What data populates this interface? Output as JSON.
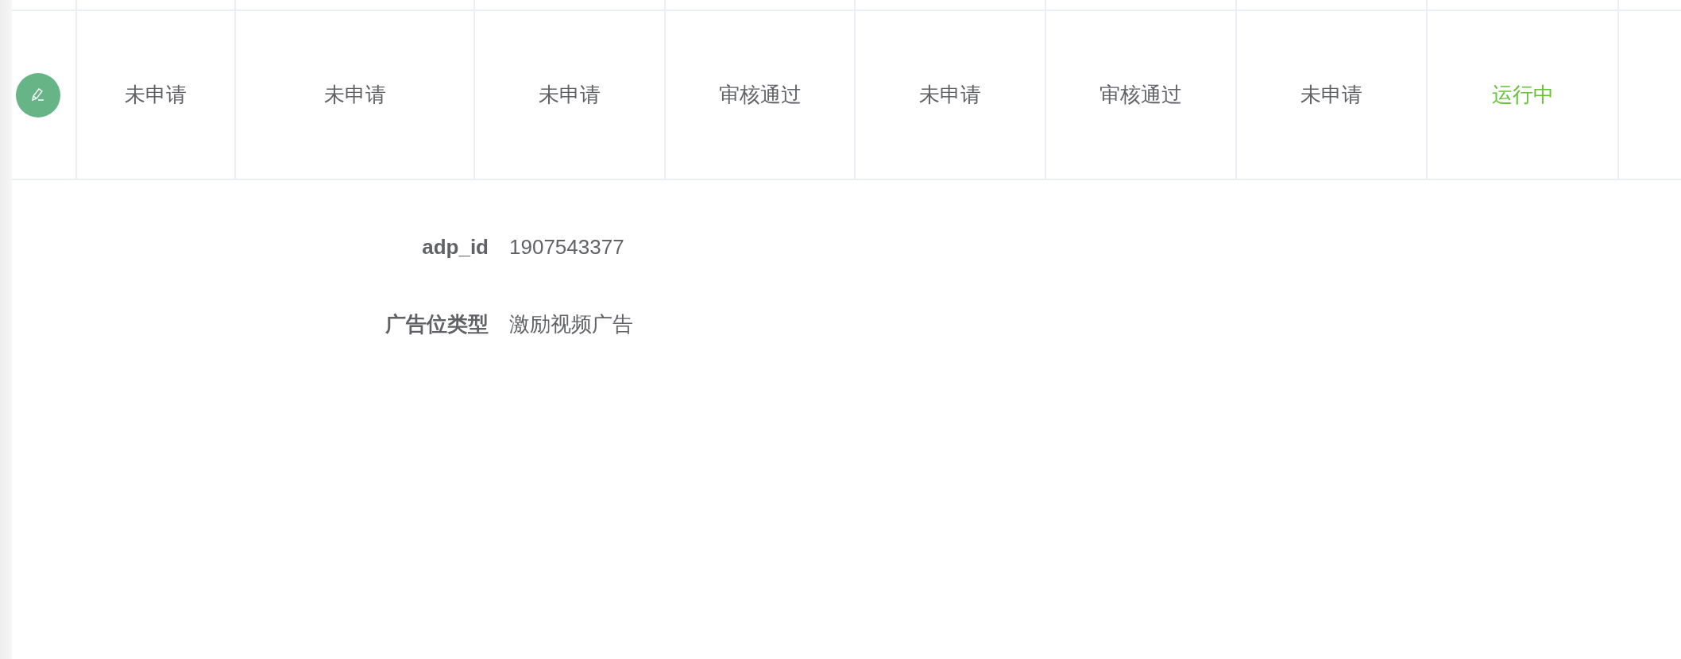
{
  "table": {
    "rows": [
      {
        "edit_button": true,
        "cells": [
          {
            "text": "未申请",
            "color": "#606266"
          },
          {
            "text": "未申请",
            "color": "#606266"
          },
          {
            "text": "未申请",
            "color": "#606266"
          },
          {
            "text": "审核通过",
            "color": "#606266"
          },
          {
            "text": "未申请",
            "color": "#606266"
          },
          {
            "text": "审核通过",
            "color": "#606266"
          },
          {
            "text": "未申请",
            "color": "#606266"
          },
          {
            "text": "运行中",
            "color": "#67c23a"
          }
        ]
      }
    ]
  },
  "details": [
    {
      "label": "adp_id",
      "value": "1907543377"
    },
    {
      "label": "广告位类型",
      "value": "激励视频广告"
    }
  ]
}
